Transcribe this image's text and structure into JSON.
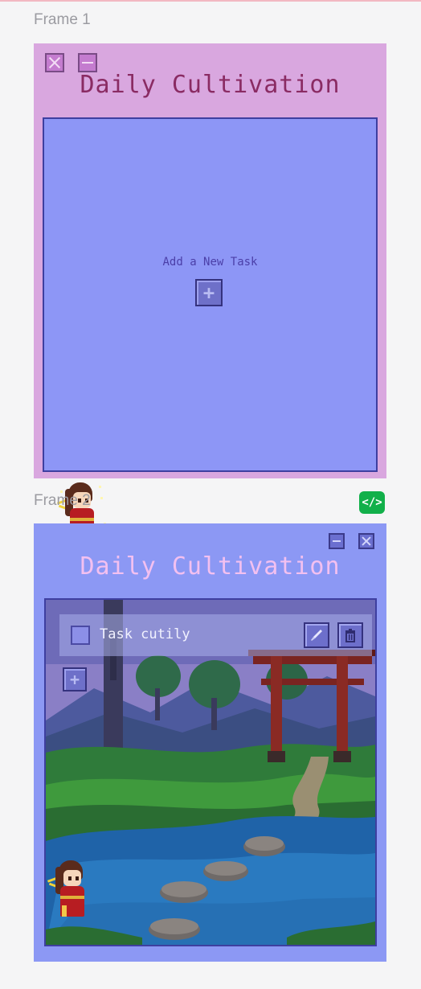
{
  "canvas": {
    "frame1_label": "Frame 1",
    "frame2_label": "Frame 2",
    "code_badge": "</>"
  },
  "frame1": {
    "title": "Daily Cultivation",
    "add_task_label": "Add a New Task",
    "add_button_icon": "plus-icon",
    "window_buttons": [
      "close-icon",
      "minimize-icon"
    ]
  },
  "frame2": {
    "title": "Daily Cultivation",
    "window_buttons": [
      "minimize-icon",
      "close-icon"
    ],
    "tasks": [
      {
        "text": "Task cutily",
        "checked": false,
        "actions": [
          "brush-edit-icon",
          "trash-icon"
        ]
      }
    ],
    "add_button_icon": "plus-icon",
    "background_scene": "torii-gate-forest-pond"
  },
  "colors": {
    "frame1_bg": "#d9a7df",
    "frame1_title": "#8a2b63",
    "panel_bg": "#8d96f6",
    "frame2_bg": "#8c98f4",
    "frame2_title": "#f3c0f0",
    "code_badge": "#12b04a"
  }
}
